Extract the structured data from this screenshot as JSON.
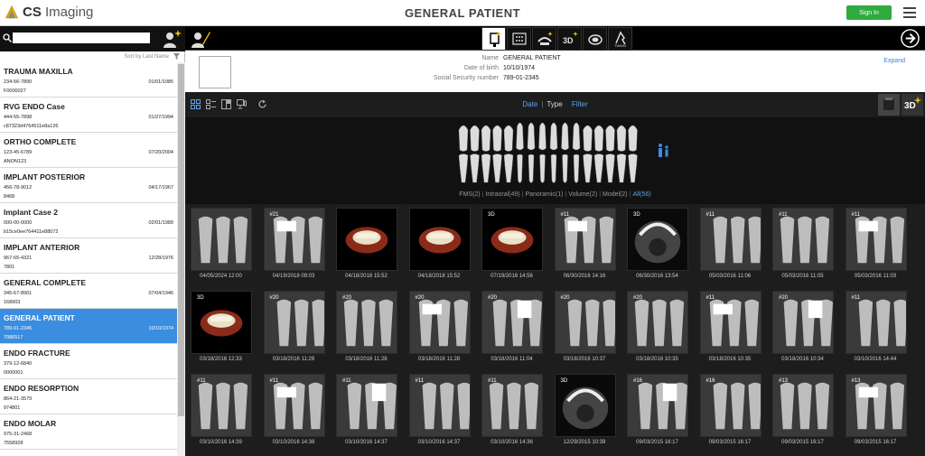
{
  "app": {
    "name_bold": "CS",
    "name_rest": "Imaging",
    "title": "GENERAL PATIENT",
    "signin_label": "Sign In"
  },
  "colors": {
    "accent": "#3b8de0",
    "signin": "#2faa3f",
    "tab_active": "#5fa4ec"
  },
  "search": {
    "value": "",
    "placeholder": ""
  },
  "sort": {
    "label": "Sort by Last Name"
  },
  "patients": [
    {
      "name": "TRAUMA MAXILLA",
      "phone": "234-56-7890",
      "dob": "01/01/1985",
      "id": "F0000027"
    },
    {
      "name": "RVG ENDO Case",
      "phone": "444-55-7898",
      "dob": "01/27/1994",
      "id": "c87323d4764511e8a126"
    },
    {
      "name": "ORTHO COMPLETE",
      "phone": "123-45-6789",
      "dob": "07/20/2004",
      "id": "ANON123"
    },
    {
      "name": "IMPLANT POSTERIOR",
      "phone": "456-78-9012",
      "dob": "04/17/1967",
      "id": "8468"
    },
    {
      "name": "Implant Case 2",
      "phone": "000-00-0000",
      "dob": "02/01/1989",
      "id": "b15ce0ee764411e88072"
    },
    {
      "name": "IMPLANT ANTERIOR",
      "phone": "967-65-4321",
      "dob": "12/28/1976",
      "id": "7801"
    },
    {
      "name": "GENERAL COMPLETE",
      "phone": "345-67-8901",
      "dob": "07/04/1946",
      "id": "168903"
    },
    {
      "name": "GENERAL PATIENT",
      "phone": "789-01-2345",
      "dob": "10/10/1974",
      "id": "7086517",
      "selected": true
    },
    {
      "name": "ENDO FRACTURE",
      "phone": "379-12-6840",
      "dob": "",
      "id": "0000001"
    },
    {
      "name": "ENDO RESORPTION",
      "phone": "864-21-3579",
      "dob": "",
      "id": "974801"
    },
    {
      "name": "ENDO MOLAR",
      "phone": "975-31-2468",
      "dob": "",
      "id": "7558928"
    }
  ],
  "patient_info": {
    "name_label": "Name",
    "name": "GENERAL PATIENT",
    "dob_label": "Date of birth",
    "dob": "10/10/1974",
    "ssn_label": "Social Security number",
    "ssn": "789-01-2345",
    "expand_label": "Expand"
  },
  "toolbar": {
    "icons": [
      "intraoral-sensor-icon",
      "scanner-icon",
      "panoramic-icon",
      "3d-icon",
      "model-scan-icon",
      "twain-icon"
    ]
  },
  "viewer": {
    "tabs": {
      "date": "Date",
      "type": "Type",
      "filter": "Filter"
    },
    "categories": [
      "FMS(2)",
      "Intraoral(49)",
      "Panoramic(1)",
      "Volume(2)",
      "Model(2)"
    ],
    "all": "All(56)",
    "thumbnails": [
      {
        "badge": "",
        "date": "04/05/2024 12:00",
        "kind": "xray"
      },
      {
        "badge": "#21",
        "date": "04/19/2018 09:03",
        "kind": "xray"
      },
      {
        "badge": "",
        "date": "04/18/2018 15:52",
        "kind": "model"
      },
      {
        "badge": "",
        "date": "04/18/2018 15:52",
        "kind": "model"
      },
      {
        "badge": "3D",
        "date": "07/19/2016 14:56",
        "kind": "model"
      },
      {
        "badge": "#11",
        "date": "06/30/2016 14:16",
        "kind": "xray"
      },
      {
        "badge": "3D",
        "date": "06/30/2016 13:54",
        "kind": "ct"
      },
      {
        "badge": "#11",
        "date": "05/03/2016 11:06",
        "kind": "xray"
      },
      {
        "badge": "#11",
        "date": "05/03/2016 11:05",
        "kind": "xray"
      },
      {
        "badge": "#11",
        "date": "05/03/2016 11:03",
        "kind": "xray"
      },
      {
        "badge": "3D",
        "date": "03/18/2016 12:33",
        "kind": "model"
      },
      {
        "badge": "#20",
        "date": "03/18/2016 11:29",
        "kind": "xray"
      },
      {
        "badge": "#20",
        "date": "03/18/2016 11:28",
        "kind": "xray"
      },
      {
        "badge": "#20",
        "date": "03/18/2016 11:28",
        "kind": "xray"
      },
      {
        "badge": "#20",
        "date": "03/18/2016 11:04",
        "kind": "xray"
      },
      {
        "badge": "#20",
        "date": "03/18/2016 10:37",
        "kind": "xray"
      },
      {
        "badge": "#20",
        "date": "03/18/2016 10:35",
        "kind": "xray"
      },
      {
        "badge": "#11",
        "date": "03/18/2016 10:35",
        "kind": "xray"
      },
      {
        "badge": "#20",
        "date": "03/18/2016 10:34",
        "kind": "xray"
      },
      {
        "badge": "#11",
        "date": "03/10/2016 14:44",
        "kind": "xray"
      },
      {
        "badge": "#11",
        "date": "03/10/2016 14:39",
        "kind": "xray"
      },
      {
        "badge": "#11",
        "date": "03/10/2016 14:38",
        "kind": "xray"
      },
      {
        "badge": "#11",
        "date": "03/10/2016 14:37",
        "kind": "xray"
      },
      {
        "badge": "#11",
        "date": "03/10/2016 14:37",
        "kind": "xray"
      },
      {
        "badge": "#11",
        "date": "03/10/2016 14:36",
        "kind": "xray"
      },
      {
        "badge": "3D",
        "date": "12/29/2015 10:39",
        "kind": "ct"
      },
      {
        "badge": "#16",
        "date": "09/03/2015 16:17",
        "kind": "xray"
      },
      {
        "badge": "#16",
        "date": "09/03/2015 16:17",
        "kind": "xray"
      },
      {
        "badge": "#13",
        "date": "09/03/2015 16:17",
        "kind": "xray"
      },
      {
        "badge": "#13",
        "date": "09/03/2015 16:17",
        "kind": "xray"
      }
    ]
  }
}
